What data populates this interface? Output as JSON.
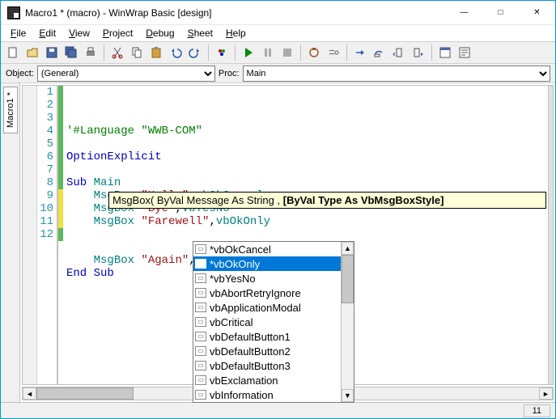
{
  "title": "Macro1 * (macro) - WinWrap Basic [design]",
  "menus": [
    "File",
    "Edit",
    "View",
    "Project",
    "Debug",
    "Sheet",
    "Help"
  ],
  "combos": {
    "object_label": "Object:",
    "object_value": "(General)",
    "proc_label": "Proc:",
    "proc_value": "Main"
  },
  "tab": "Macro1 *",
  "code": {
    "lines": [
      {
        "n": 1,
        "ch": "g",
        "segs": [
          [
            "comment",
            "'#Language \"WWB-COM\""
          ]
        ]
      },
      {
        "n": 2,
        "ch": "g",
        "segs": []
      },
      {
        "n": 3,
        "ch": "g",
        "segs": [
          [
            "kw",
            "Option"
          ],
          [
            "",
            ""
          ],
          [
            "kw",
            "Explicit"
          ]
        ]
      },
      {
        "n": 4,
        "ch": "g",
        "segs": []
      },
      {
        "n": 5,
        "ch": "g",
        "segs": [
          [
            "kw",
            "Sub"
          ],
          [
            "",
            " "
          ],
          [
            "type",
            "Main"
          ]
        ]
      },
      {
        "n": 6,
        "ch": "g",
        "segs": [
          [
            "",
            "    "
          ],
          [
            "type",
            "MsgBox"
          ],
          [
            "",
            " "
          ],
          [
            "str",
            "\"Hello\""
          ],
          [
            "",
            ","
          ],
          [
            "const",
            "vbOkCancel"
          ]
        ]
      },
      {
        "n": 7,
        "ch": "g",
        "segs": [
          [
            "",
            "    "
          ],
          [
            "type",
            "MsgBox"
          ],
          [
            "",
            " "
          ],
          [
            "str",
            "\"Bye\""
          ],
          [
            "",
            ","
          ],
          [
            "const",
            "vbYesNo"
          ]
        ]
      },
      {
        "n": 8,
        "ch": "g",
        "segs": [
          [
            "",
            "    "
          ],
          [
            "type",
            "MsgBox"
          ],
          [
            "",
            " "
          ],
          [
            "str",
            "\"Farewell\""
          ],
          [
            "",
            ","
          ],
          [
            "const",
            "vbOkOnly"
          ]
        ]
      },
      {
        "n": 9,
        "ch": "y",
        "segs": []
      },
      {
        "n": 10,
        "ch": "y",
        "segs": []
      },
      {
        "n": 11,
        "ch": "y",
        "segs": [
          [
            "",
            "    "
          ],
          [
            "type",
            "MsgBox"
          ],
          [
            "",
            " "
          ],
          [
            "str",
            "\"Again\""
          ],
          [
            "",
            ","
          ]
        ],
        "cursor": true
      },
      {
        "n": 12,
        "ch": "g",
        "segs": [
          [
            "kw",
            "End"
          ],
          [
            "",
            " "
          ],
          [
            "kw",
            "Sub"
          ]
        ]
      }
    ]
  },
  "tooltip": {
    "pre": "MsgBox( ByVal Message As String , ",
    "bold": "[ByVal Type As VbMsgBoxStyle]"
  },
  "intellisense": {
    "items": [
      "*vbOkCancel",
      "*vbOkOnly",
      "*vbYesNo",
      "vbAbortRetryIgnore",
      "vbApplicationModal",
      "vbCritical",
      "vbDefaultButton1",
      "vbDefaultButton2",
      "vbDefaultButton3",
      "vbExclamation",
      "vbInformation"
    ],
    "selected": 1
  },
  "status": {
    "col": "11"
  }
}
